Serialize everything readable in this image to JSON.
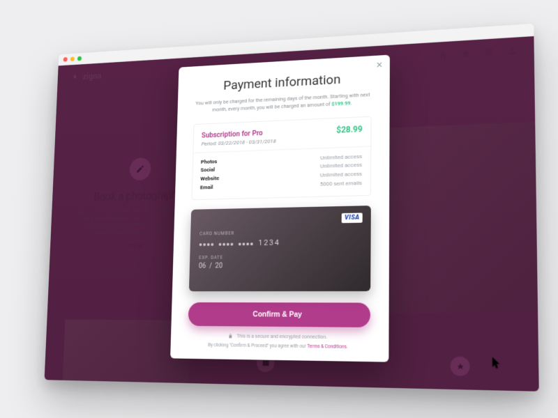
{
  "brand": {
    "name": "zigna"
  },
  "background": {
    "leftTitle": "Book a photographer",
    "leftBody": "Lorem ipsum dolor sit amet. There are some hard and fast things that graphic designers will insist are to be obeyed. Only one unification on a design for example or never use screen fab a magazine or book cover as people will not love it.",
    "leftCta": "Let's go →"
  },
  "modal": {
    "title": "Payment information",
    "subtitlePrefix": "You will only be charged for the remaining days of the month. Starting with next month, every month, you will be charged an amount of ",
    "monthlyAmount": "$199.99",
    "subtitleSuffix": ".",
    "plan": {
      "label": "Subscription for Pro",
      "periodLabel": "Period:",
      "periodValue": "03/22/2018 - 03/31/2018",
      "price": "$28.99"
    },
    "features": [
      {
        "key": "Photos",
        "value": "Unlimited access"
      },
      {
        "key": "Social",
        "value": "Unlimited access"
      },
      {
        "key": "Website",
        "value": "Unlimited access"
      },
      {
        "key": "Email",
        "value": "5000 sent emails"
      }
    ],
    "card": {
      "brand": "VISA",
      "numberLabel": "CARD NUMBER",
      "last4": "1234",
      "expLabel": "EXP. DATE",
      "expMonth": "06",
      "expSep": "/",
      "expYear": "20"
    },
    "confirmLabel": "Confirm & Pay",
    "secureText": "This is a secure and encrypted connection.",
    "termsPrefix": "By clicking \"Confirm & Proceed\" you agree with our ",
    "termsLink": "Terms & Conditions",
    "termsSuffix": "."
  }
}
